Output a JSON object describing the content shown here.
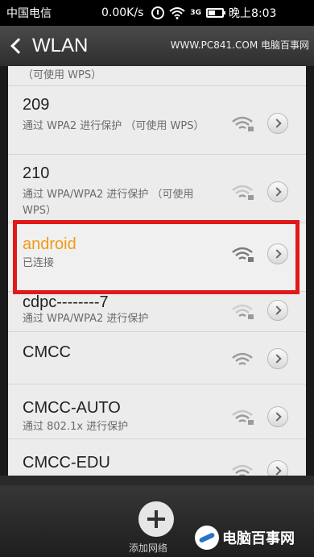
{
  "status_bar": {
    "carrier": "中国电信",
    "speed": "0.00K/s",
    "network_type": "3G",
    "time": "晚上8:03"
  },
  "header": {
    "title": "WLAN",
    "watermark": "WWW.PC841.COM 电脑百事网"
  },
  "networks": [
    {
      "name": "",
      "sub": "（可使用 WPS）"
    },
    {
      "name": "209",
      "sub": "通过 WPA2 进行保护 （可使用 WPS）"
    },
    {
      "name": "210",
      "sub": "通过 WPA/WPA2 进行保护 （可使用 WPS）"
    },
    {
      "name": "android",
      "sub": "已连接",
      "connected": true
    },
    {
      "name": "cdpc--------7",
      "sub": "通过 WPA/WPA2 进行保护"
    },
    {
      "name": "CMCC",
      "sub": ""
    },
    {
      "name": "CMCC-AUTO",
      "sub": "通过 802.1x 进行保护"
    },
    {
      "name": "CMCC-EDU",
      "sub": ""
    }
  ],
  "bottom": {
    "add_label": "添加网络",
    "logo_text": "电脑百事网"
  },
  "colors": {
    "connected": "#f29a15",
    "highlight": "#e01a1a"
  }
}
